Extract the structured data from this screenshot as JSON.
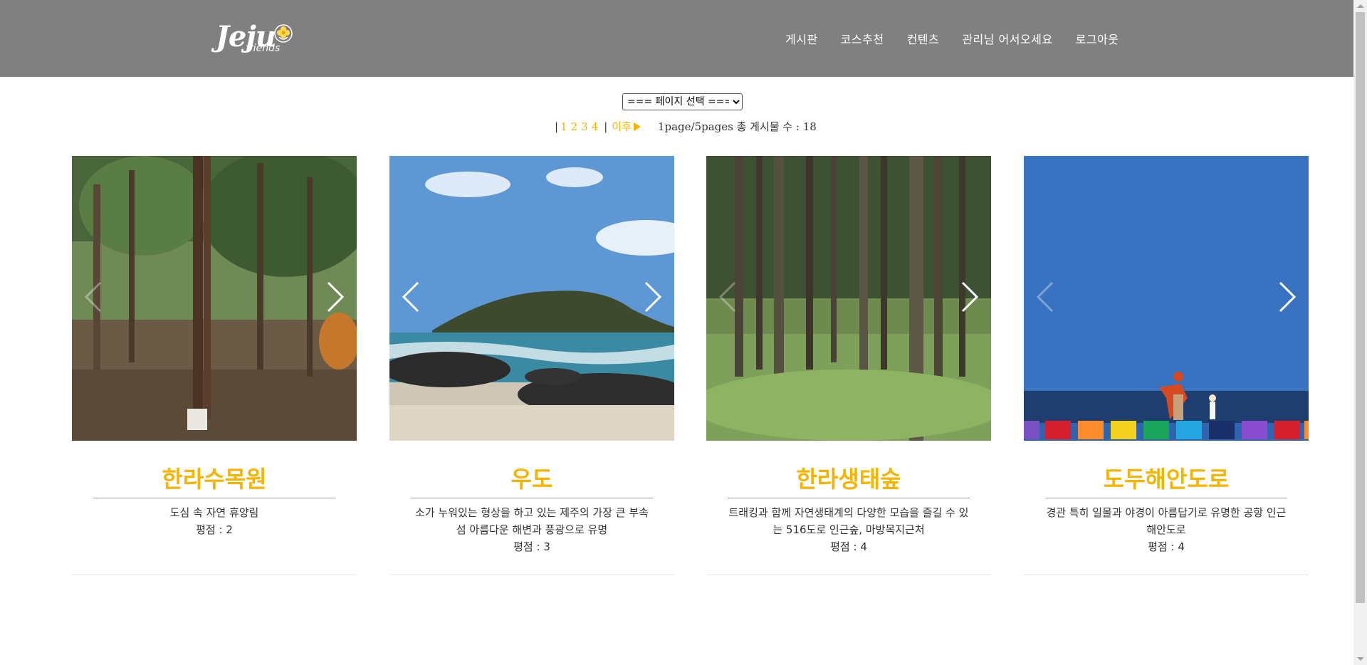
{
  "header": {
    "logo": {
      "text": "Jeju",
      "subtext": "friends"
    },
    "nav": [
      "게시판",
      "코스추천",
      "컨텐츠",
      "관리님 어서오세요",
      "로그아웃"
    ]
  },
  "page_select": {
    "selected": "=== 페이지 선택 ==="
  },
  "paging": {
    "pages": [
      "1",
      "2",
      "3",
      "4"
    ],
    "next_label": "이후",
    "info": "1page/5pages 총 게시물 수 : 18"
  },
  "cards": [
    {
      "title": "한라수목원",
      "desc": "도심 속 자연 휴양림",
      "rating": "평점 : 2",
      "image": "forest-arboretum"
    },
    {
      "title": "우도",
      "desc": "소가 누워있는 형상을 하고 있는 제주의 가장 큰 부속섬 아름다운 해변과 풍광으로 유명",
      "rating": "평점 : 3",
      "image": "island-beach"
    },
    {
      "title": "한라생태숲",
      "desc": "트래킹과 함께 자연생태계의 다양한 모습을 즐길 수 있는 516도로 인근숲, 마방목지근처",
      "rating": "평점 : 4",
      "image": "cedar-forest"
    },
    {
      "title": "도두해안도로",
      "desc": "경관 특히 일몰과 야경이 아름답기로 유명한 공항 인근 해안도로",
      "rating": "평점 : 4",
      "image": "coastal-road-sea"
    }
  ],
  "colors": {
    "header_bg": "#808080",
    "accent": "#f5b400"
  },
  "icons": {
    "prev": "chevron-left-icon",
    "next": "chevron-right-icon",
    "next_page": "triangle-right-icon"
  }
}
